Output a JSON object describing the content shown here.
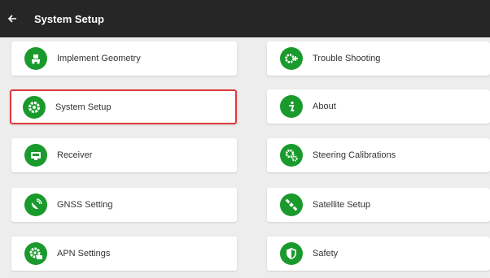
{
  "header": {
    "title": "System Setup"
  },
  "left_items": [
    {
      "label": "Implement Geometry",
      "icon": "tractor-icon",
      "selected": false
    },
    {
      "label": "System Setup",
      "icon": "gear-icon",
      "selected": true
    },
    {
      "label": "Receiver",
      "icon": "receiver-icon",
      "selected": false
    },
    {
      "label": "GNSS Setting",
      "icon": "satellite-dish-icon",
      "selected": false
    },
    {
      "label": "APN Settings",
      "icon": "gear-apn-icon",
      "selected": false
    }
  ],
  "right_items": [
    {
      "label": "Trouble Shooting",
      "icon": "wrench-gear-icon"
    },
    {
      "label": "About",
      "icon": "info-icon"
    },
    {
      "label": "Steering Calibrations",
      "icon": "gears-icon"
    },
    {
      "label": "Satellite Setup",
      "icon": "satellite-icon"
    },
    {
      "label": "Safety",
      "icon": "shield-icon"
    }
  ],
  "colors": {
    "accent": "#1a9a2c",
    "topbar": "#262626",
    "selected_border": "#e03a3a"
  }
}
